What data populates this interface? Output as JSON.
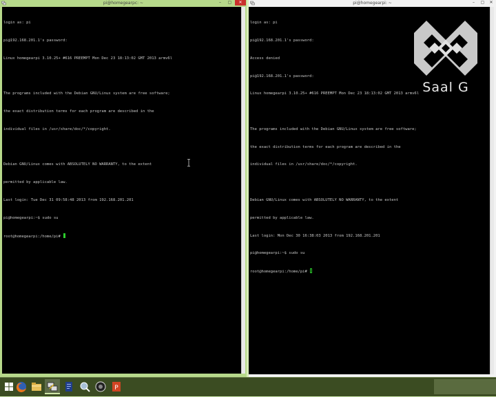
{
  "left_window": {
    "title": "pi@homegearpc: ~",
    "close_label": "✕",
    "min_label": "–",
    "max_label": "▢",
    "lines": [
      "login as: pi",
      "pi@192.168.201.1's password:",
      "Linux homegearpi 3.10.25+ #616 PREEMPT Mon Dec 23 18:13:02 GMT 2013 armv6l",
      "",
      "The programs included with the Debian GNU/Linux system are free software;",
      "the exact distribution terms for each program are described in the",
      "individual files in /usr/share/doc/*/copyright.",
      "",
      "Debian GNU/Linux comes with ABSOLUTELY NO WARRANTY, to the extent",
      "permitted by applicable law.",
      "Last login: Tue Dec 31 09:58:48 2013 from 192.168.201.201",
      "pi@homegearpi:~$ sudo su"
    ],
    "prompt": "root@homegearpi:/home/pi#"
  },
  "right_window": {
    "title": "pi@homegearpi: ~",
    "close_label": "✕",
    "min_label": "–",
    "max_label": "▢",
    "lines": [
      "login as: pi",
      "pi@192.168.201.1's password:",
      "Access denied",
      "pi@192.168.201.1's password:",
      "Linux homegearpi 3.10.25+ #616 PREEMPT Mon Dec 23 18:13:02 GMT 2013 armv6l",
      "",
      "The programs included with the Debian GNU/Linux system are free software;",
      "the exact distribution terms for each program are described in the",
      "individual files in /usr/share/doc/*/copyright.",
      "",
      "Debian GNU/Linux comes with ABSOLUTELY NO WARRANTY, to the extent",
      "permitted by applicable law.",
      "Last login: Mon Dec 30 16:38:03 2013 from 192.168.201.201",
      "pi@homegearpi:~$ sudo su"
    ],
    "prompt": "root@homegearpi:/home/pi#"
  },
  "watermark": {
    "text": "Saal G",
    "icon": "saal-g-logo-icon"
  },
  "taskbar": {
    "items": [
      {
        "name": "start-button",
        "icon": "windows-logo-icon"
      },
      {
        "name": "firefox",
        "icon": "firefox-icon"
      },
      {
        "name": "file-explorer",
        "icon": "folder-icon"
      },
      {
        "name": "putty",
        "icon": "putty-icon"
      },
      {
        "name": "app-blue",
        "icon": "document-icon"
      },
      {
        "name": "app-tools",
        "icon": "tools-icon"
      },
      {
        "name": "app-speaker",
        "icon": "speaker-icon"
      },
      {
        "name": "powerpoint",
        "icon": "powerpoint-icon"
      }
    ]
  },
  "colors": {
    "terminal_bg": "#000000",
    "terminal_text": "#c8c8c8",
    "cursor": "#2ccd2c",
    "left_frame": "#b7d98b",
    "taskbar": "#3b4c22"
  }
}
